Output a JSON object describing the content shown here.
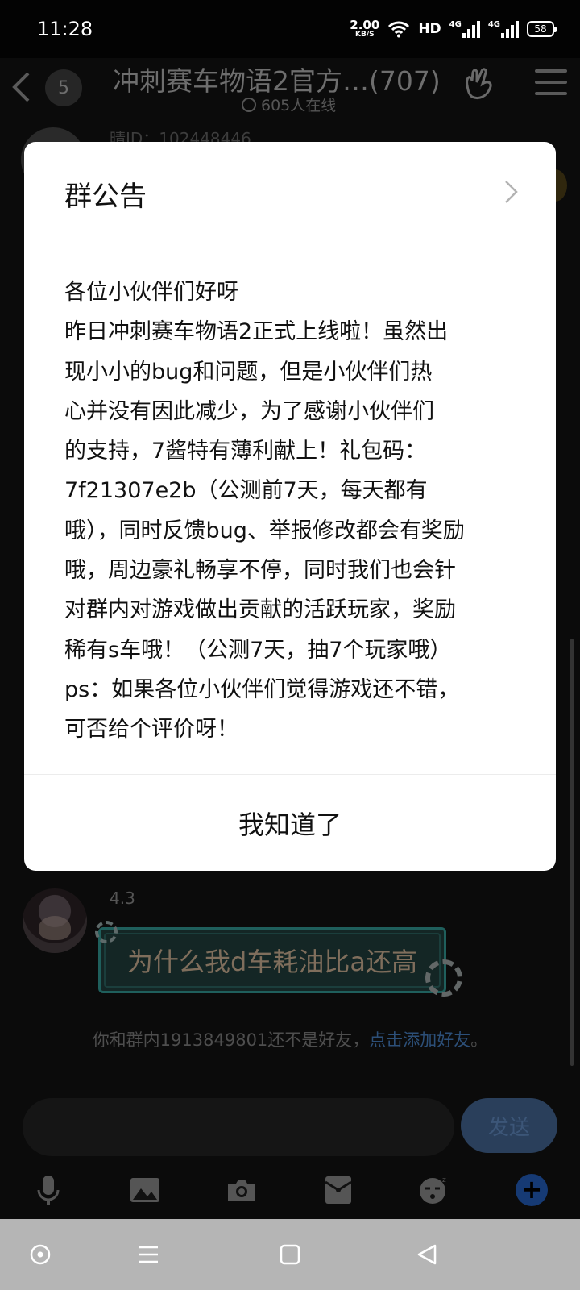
{
  "status_bar": {
    "time": "11:28",
    "net_speed_value": "2.00",
    "net_speed_unit": "KB/S",
    "hd_label": "HD",
    "network_1": "4G",
    "network_2": "4G",
    "battery": "58"
  },
  "header": {
    "unread_count": "5",
    "title": "冲刺赛车物语2官方…(707)",
    "online_text": "605人在线"
  },
  "background_messages": {
    "prev_sender_id": "晴ID：102448446",
    "sender_name": "4.3",
    "message_text": "为什么我d车耗油比a还高",
    "friend_notice_prefix": "你和群内1913849801还不是好友，",
    "friend_notice_link": "点击添加好友",
    "friend_notice_suffix": "。"
  },
  "input_bar": {
    "send_label": "发送",
    "plus_label": "+"
  },
  "dialog": {
    "title": "群公告",
    "body_lines": [
      "各位小伙伴们好呀",
      "昨日冲刺赛车物语2正式上线啦！虽然出",
      "现小小的bug和问题，但是小伙伴们热",
      "心并没有因此减少，为了感谢小伙伴们",
      "的支持，7酱特有薄利献上！礼包码：",
      "7f21307e2b（公测前7天，每天都有",
      "哦），同时反馈bug、举报修改都会有奖励",
      "哦，周边豪礼畅享不停，同时我们也会针",
      "对群内对游戏做出贡献的活跃玩家，奖励",
      "稀有s车哦！（公测7天，抽7个玩家哦）",
      "ps：如果各位小伙伴们觉得游戏还不错，",
      "可否给个评价呀！"
    ],
    "confirm_label": "我知道了"
  }
}
